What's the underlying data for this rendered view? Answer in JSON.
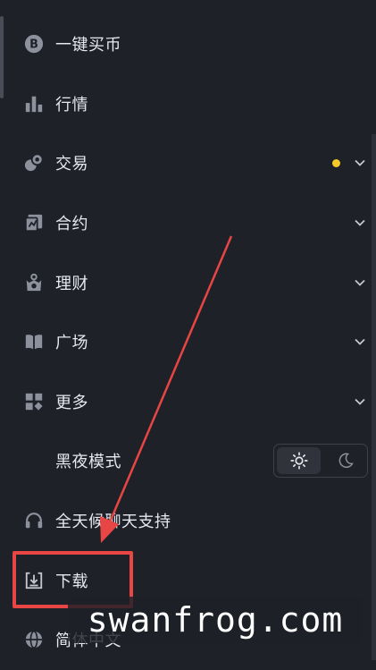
{
  "menu": {
    "items": [
      {
        "icon": "bitcoin-circle-icon",
        "label": "一键买币"
      },
      {
        "icon": "bar-chart-icon",
        "label": "行情"
      },
      {
        "icon": "exchange-icon",
        "label": "交易"
      },
      {
        "icon": "contract-icon",
        "label": "合约"
      },
      {
        "icon": "finance-icon",
        "label": "理财"
      },
      {
        "icon": "square-book-icon",
        "label": "广场"
      },
      {
        "icon": "grid-more-icon",
        "label": "更多"
      },
      {
        "label": "黑夜模式"
      },
      {
        "icon": "headset-icon",
        "label": "全天候聊天支持"
      },
      {
        "icon": "download-icon",
        "label": "下载"
      },
      {
        "icon": "globe-icon",
        "label": "简体中文"
      }
    ]
  },
  "theme_toggle": {
    "options": [
      "sun-icon",
      "moon-icon"
    ],
    "selected": "sun-icon"
  },
  "notification_dot_color": "#f5c928",
  "highlight_color": "#e84545",
  "watermark": "swanfrog.com"
}
